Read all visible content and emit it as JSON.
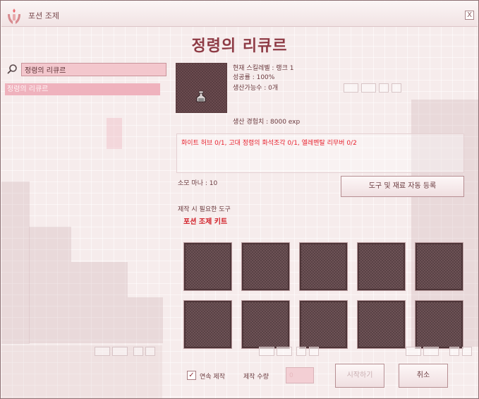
{
  "window": {
    "title": "포션 조제",
    "close_label": "X"
  },
  "recipe": {
    "title": "정령의 리큐르",
    "skill_level": "현재 스킬레벨 : 랭크 1",
    "success_rate": "성공률 : 100%",
    "producible_count": "생산가능수 : 0개",
    "production_exp": "생산 경험치 : 8000 exp",
    "materials": "화이트 허브 0/1, 고대 정령의 화석조각 0/1, 엘레멘탈 리무버 0/2",
    "mana_cost": "소모 마나 : 10",
    "tools_label": "제작 시 필요한 도구",
    "tool_name": "포션 조제 키트"
  },
  "search": {
    "value": "정령의 리큐르"
  },
  "recipe_list": [
    {
      "label": "정령의 리큐르"
    }
  ],
  "buttons": {
    "auto_register": "도구 및 재료 자동 등록",
    "start": "시작하기",
    "cancel": "취소"
  },
  "controls": {
    "continuous_label": "연속 제작",
    "continuous_checked": "✓",
    "quantity_label": "제작 수량",
    "quantity_value": "0"
  },
  "icons": {
    "app": "potion-hands-icon",
    "search": "search-icon",
    "item": "potion-bottle-icon"
  },
  "colors": {
    "title": "#8e3b45",
    "materials": "#e8222f",
    "tool": "#d11c25",
    "selection": "#efb2bd"
  }
}
